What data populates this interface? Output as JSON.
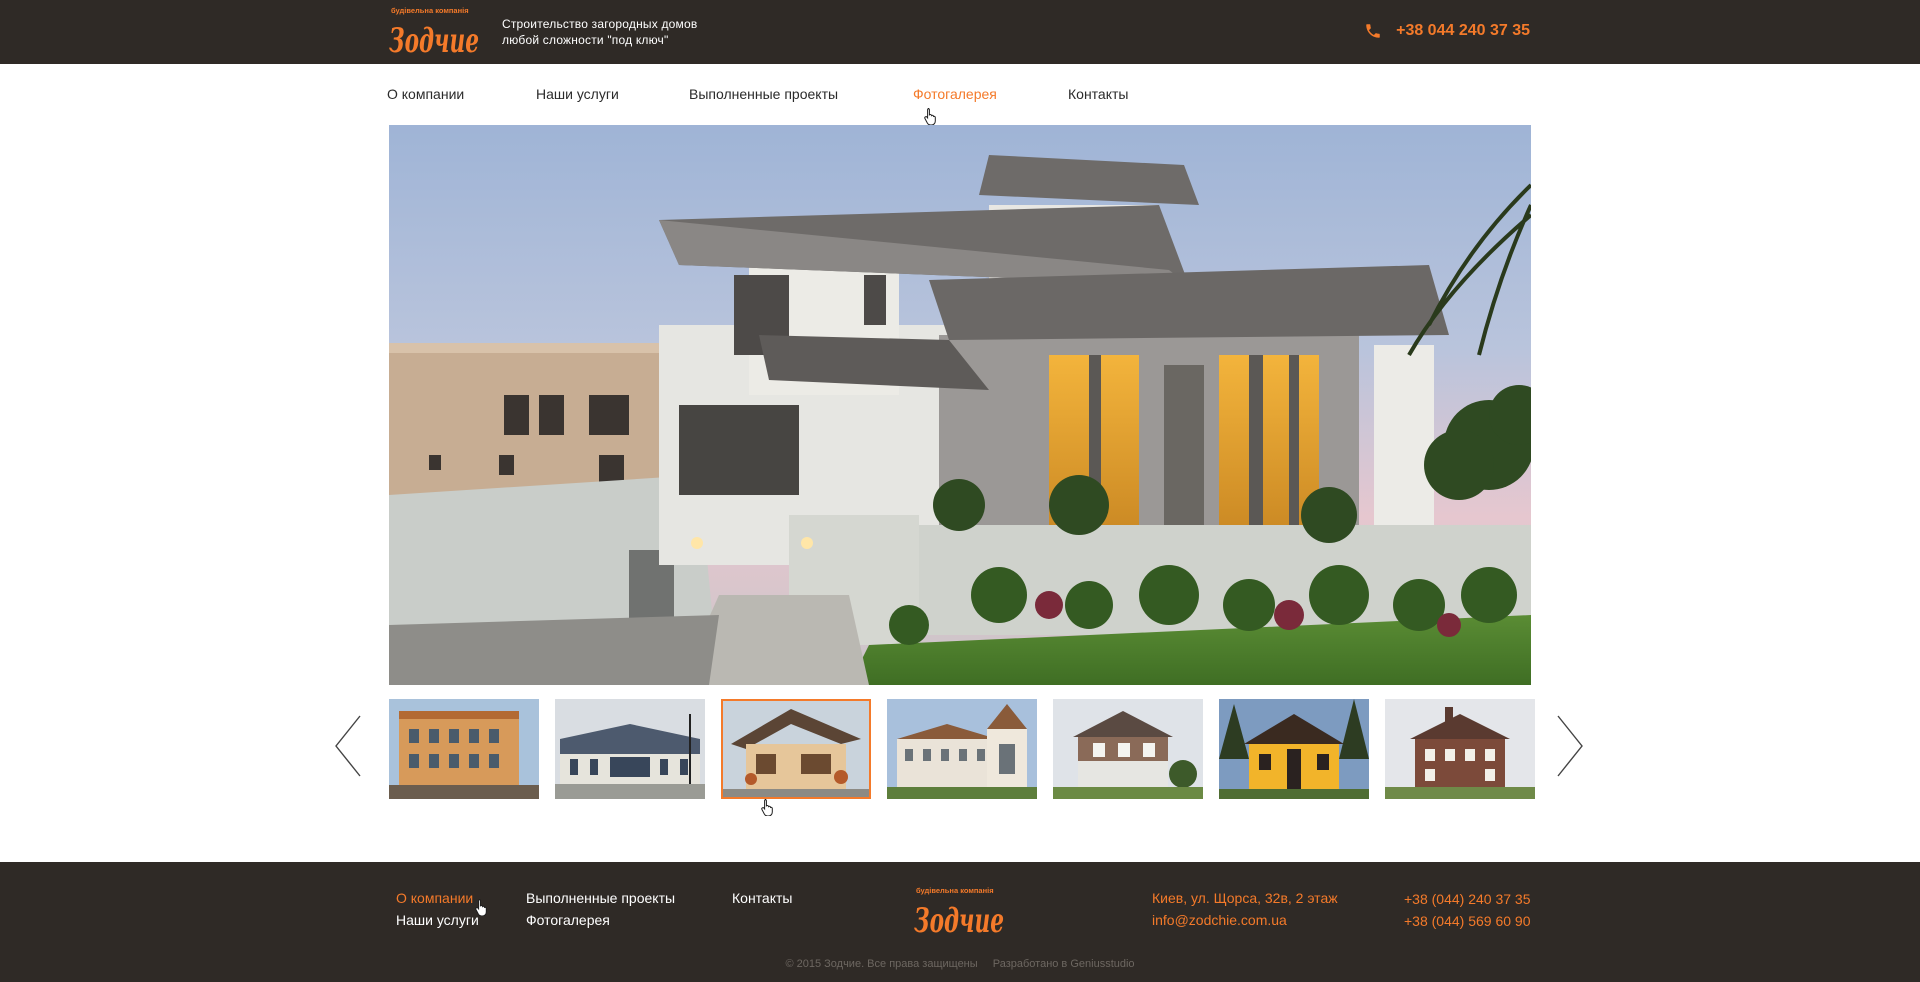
{
  "header": {
    "logo_small_text": "будівельна компанія",
    "logo_text": "Зодчие",
    "tagline_line1": "Строительство загородных домов",
    "tagline_line2": "любой сложности \"под ключ\"",
    "phone": "+38 044 240 37 35",
    "icons": {
      "phone": "phone-icon"
    }
  },
  "nav": {
    "items": [
      {
        "label": "О компании",
        "active": false
      },
      {
        "label": "Наши услуги",
        "active": false
      },
      {
        "label": "Выполненные проекты",
        "active": false
      },
      {
        "label": "Фотогалерея",
        "active": true
      },
      {
        "label": "Контакты",
        "active": false
      }
    ]
  },
  "gallery": {
    "selected_index": 2,
    "thumbnails_count": 7,
    "icons": {
      "prev": "chevron-left-icon",
      "next": "chevron-right-icon"
    }
  },
  "footer": {
    "links": [
      {
        "label": "О компании",
        "active": true
      },
      {
        "label": "Наши услуги",
        "active": false
      },
      {
        "label": "Выполненные проекты",
        "active": false
      },
      {
        "label": "Фотогалерея",
        "active": false
      },
      {
        "label": "Контакты",
        "active": false
      }
    ],
    "logo_small_text": "будівельна компанія",
    "logo_text": "Зодчие",
    "address": "Киев, ул. Щорса, 32в, 2 этаж",
    "email": "info@zodchie.com.ua",
    "phone1": "+38 (044) 240 37 35",
    "phone2": "+38 (044) 569 60 90",
    "copyright": "© 2015 Зодчие. Все права защищены",
    "developer": "Разработано в Geniusstudio"
  },
  "colors": {
    "accent": "#f47a2a",
    "dark_bg": "#2f2a26",
    "text": "#2b2b2b"
  }
}
